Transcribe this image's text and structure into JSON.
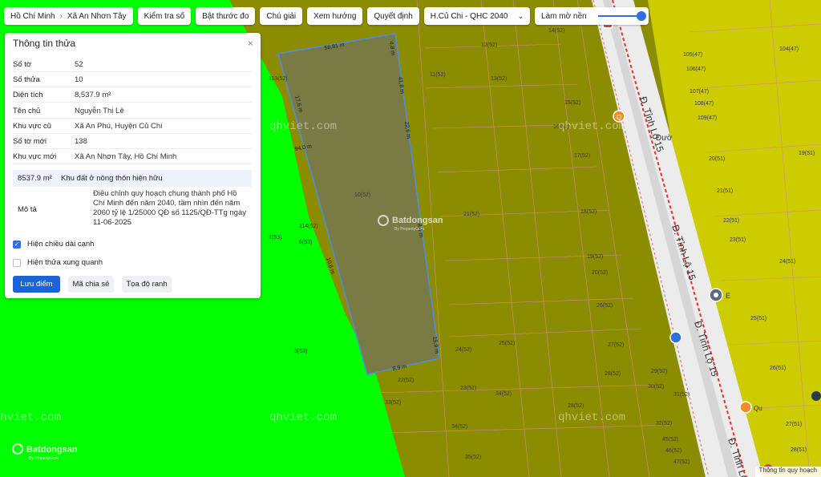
{
  "topbar": {
    "breadcrumb": [
      "Hồ Chí Minh",
      "Xã An Nhơn Tây"
    ],
    "buttons": [
      "Kiểm tra số",
      "Bật thước đo",
      "Chú giải",
      "Xem hướng",
      "Quyết định"
    ],
    "plan_select": "H.Củ Chi - QHC 2040",
    "fade_label": "Làm mờ nền",
    "fade_level": 1.0
  },
  "panel": {
    "title": "Thông tin thửa",
    "close": "×",
    "rows": [
      {
        "label": "Số tờ",
        "value": "52"
      },
      {
        "label": "Số thửa",
        "value": "10"
      },
      {
        "label": "Diện tích",
        "value": "8,537.9 m²"
      },
      {
        "label": "Tên chủ",
        "value": "Nguyễn Thị Lê"
      },
      {
        "label": "Khu vực cũ",
        "value": "Xã An Phú, Huyện Củ Chi"
      },
      {
        "label": "Số tờ mới",
        "value": "138"
      },
      {
        "label": "Khu vực mới",
        "value": "Xã An Nhơn Tây, Hồ Chí Minh"
      }
    ],
    "zone_area": "8537.9 m²",
    "zone_type": "Khu đất ở nông thôn hiện hữu",
    "desc_label": "Mô tả",
    "desc_text": "Điều chỉnh quy hoạch chung thành phố Hồ Chí Minh đến năm 2040, tầm nhìn đến năm 2060 tỷ lệ 1/25000 QĐ số 1125/QĐ-TTg ngày 11-06-2025",
    "checkboxes": [
      {
        "label": "Hiện chiều dài cạnh",
        "checked": true
      },
      {
        "label": "Hiện thửa xung quanh",
        "checked": false
      }
    ],
    "buttons": {
      "save": "Lưu điểm",
      "share": "Mã chia sẻ",
      "coords": "Tọa độ ranh"
    }
  },
  "map": {
    "colors": {
      "green": "#00ff00",
      "olive": "#8c8c00",
      "yellow": "#cccc00",
      "road": "#ececec",
      "parcel_fill": "#7a7a44",
      "parcel_edge": "#4d8de6",
      "red_line": "#e83030"
    },
    "selected_parcel": "10(52)",
    "road_name": "Đ. Tỉnh Lộ 15",
    "road_name_2": "Đườ",
    "watermark": "qhviet.com",
    "logo_text": "Batdongsan",
    "logo_sub": "By PropertyGuru",
    "poi_labels": [
      "Q",
      "G",
      "E",
      "Qu"
    ],
    "edge_lengths": [
      "58,81 m",
      "4,8 m",
      "41,8 m",
      "22,6 m",
      "8,4 m",
      "15,9 m",
      "8,9 m",
      "17,6 m",
      "94,0 m",
      "10,6 m",
      "38,6 m"
    ],
    "parcel_labels": [
      "14(52)",
      "12(52)",
      "11(52)",
      "13(52)",
      "113(52)",
      "15(52)",
      "16(52)",
      "17(52)",
      "10(52)",
      "21(52)",
      "18(52)",
      "19(52)",
      "20(52)",
      "26(52)",
      "25(52)",
      "27(52)",
      "28(52)",
      "29(52)",
      "30(52)",
      "31(52)",
      "34(52)",
      "33(52)",
      "22(52)",
      "23(52)",
      "24(52)",
      "34(52)",
      "35(52)",
      "32(52)",
      "45(52)",
      "46(52)",
      "47(52)",
      "28(52)",
      "114(52)",
      "6(53)",
      "1(53)",
      "3(53)",
      "105(47)",
      "106(47)",
      "107(47)",
      "108(47)",
      "109(47)",
      "104(47)",
      "19(51)",
      "20(51)",
      "21(51)",
      "22(51)",
      "23(51)",
      "24(51)",
      "25(51)",
      "26(51)",
      "27(51)",
      "28(51)"
    ]
  },
  "attribution": "Thông tin quy hoạch"
}
